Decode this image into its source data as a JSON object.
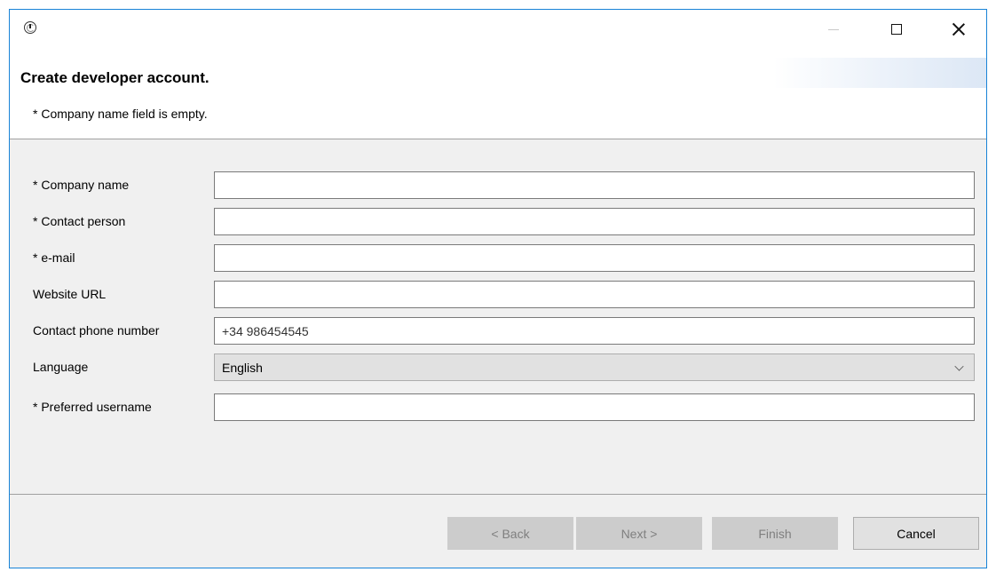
{
  "window": {
    "title": "",
    "controls": [
      "minimize",
      "maximize",
      "close"
    ]
  },
  "header": {
    "title": "Create developer account.",
    "message": "* Company name field is empty."
  },
  "form": {
    "fields": [
      {
        "label": "* Company name",
        "value": ""
      },
      {
        "label": "* Contact person",
        "value": ""
      },
      {
        "label": "* e-mail",
        "value": ""
      },
      {
        "label": "Website URL",
        "value": ""
      },
      {
        "label": "Contact phone number",
        "value": "+34 986454545"
      },
      {
        "label": "Language",
        "value": "English",
        "type": "select"
      },
      {
        "label": "* Preferred username",
        "value": ""
      }
    ]
  },
  "buttons": {
    "back": "< Back",
    "next": "Next >",
    "finish": "Finish",
    "cancel": "Cancel"
  },
  "colors": {
    "window_border": "#1883d7",
    "dialog_bg": "#f0f0f0",
    "disabled_button": "#cccccc"
  }
}
